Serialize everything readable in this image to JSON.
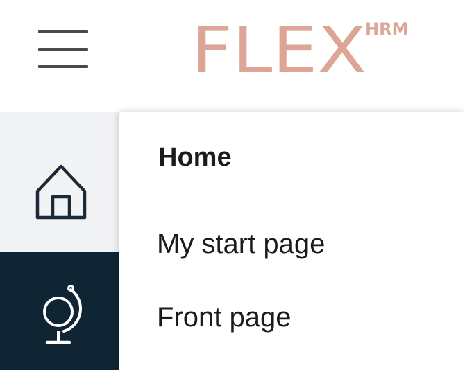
{
  "header": {
    "logo_text": "FLEX",
    "logo_superscript": "HRM",
    "menu_icon": "hamburger-icon"
  },
  "sidebar": {
    "items": [
      {
        "icon": "home-icon",
        "active": false
      },
      {
        "icon": "globe-icon",
        "active": true
      }
    ]
  },
  "flyout": {
    "title": "Home",
    "items": [
      {
        "label": "My start page"
      },
      {
        "label": "Front page"
      }
    ]
  },
  "colors": {
    "brand": "#dda595",
    "sidebar_active_bg": "#0f2534",
    "sidebar_bg": "#f2f3f4",
    "text": "#1b1b1b"
  }
}
